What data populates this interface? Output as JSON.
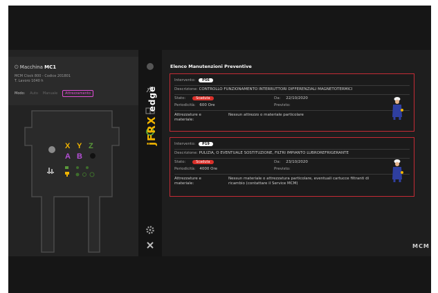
{
  "machine": {
    "name_prefix": "Macchina",
    "name": "MC1",
    "model": "MCM Clock 800 - Codice 201801",
    "hours": "T. Lavoro 1040 h",
    "mode_label": "Modo:",
    "modes": [
      "Auto",
      "Manuale",
      "Attrezzamento"
    ],
    "axes": [
      "X",
      "Y",
      "Z",
      "A",
      "B"
    ]
  },
  "brand": {
    "prefix": "jFRX",
    "suffix": "edge"
  },
  "content": {
    "title": "Elenco Manutenzioni Preventive",
    "cards": [
      {
        "intervento_label": "Intervento:",
        "code": "P56",
        "descr_label": "Descrizione:",
        "descr": "CONTROLLO FUNZIONAMENTO INTERRUTTORI DIFFERENZIALI MAGNETOTERMICI",
        "stato_label": "Stato:",
        "stato": "Scaduta",
        "da_label": "Da:",
        "da": "22/10/2020",
        "period_label": "Periodicità:",
        "period": "600 Ore",
        "previsto_label": "Previsto:",
        "attr_label": "Attrezzature e materiale:",
        "attr": "Nessun attrezzo o materiale particolare"
      },
      {
        "intervento_label": "Intervento:",
        "code": "P19",
        "descr_label": "Descrizione:",
        "descr": "PULIZIA, O EVENTUALE SOSTITUZIONE, FILTRI IMPIANTO LUBROREFRIGERANTE",
        "stato_label": "Stato:",
        "stato": "Scaduta",
        "da_label": "Da:",
        "da": "23/10/2020",
        "period_label": "Periodicità:",
        "period": "4000 Ore",
        "previsto_label": "Previsto:",
        "attr_label": "Attrezzature e materiale:",
        "attr": "Nessun materiale o attrezzatura particolare, eventuali cartucce filtranti di ricambio (contattare il Service MCM)"
      }
    ]
  },
  "logo": "MCM",
  "colors": {
    "accent_red": "#c62b35",
    "brand_yellow": "#f0b400",
    "mode_magenta": "#e24cd6"
  }
}
